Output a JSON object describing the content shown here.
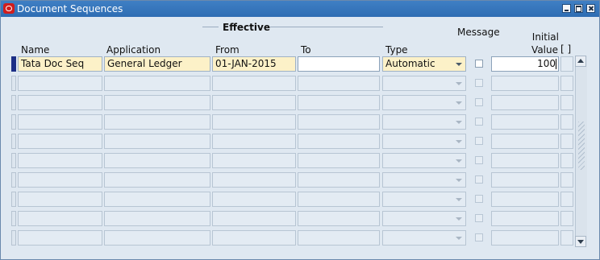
{
  "window": {
    "title": "Document Sequences",
    "app_icon": "oracle-icon"
  },
  "group": {
    "title": "Effective"
  },
  "headers": {
    "name": "Name",
    "application": "Application",
    "from": "From",
    "to": "To",
    "type": "Type",
    "message": "Message",
    "initial_line1": "Initial",
    "initial_line2": "Value",
    "bracket": "[ ]"
  },
  "rows": [
    {
      "name": "Tata Doc Seq",
      "application": "General Ledger",
      "from": "01-JAN-2015",
      "to": "",
      "type": "Automatic",
      "message": false,
      "initial_value": "100"
    },
    {
      "name": "",
      "application": "",
      "from": "",
      "to": "",
      "type": "",
      "message": false,
      "initial_value": ""
    },
    {
      "name": "",
      "application": "",
      "from": "",
      "to": "",
      "type": "",
      "message": false,
      "initial_value": ""
    },
    {
      "name": "",
      "application": "",
      "from": "",
      "to": "",
      "type": "",
      "message": false,
      "initial_value": ""
    },
    {
      "name": "",
      "application": "",
      "from": "",
      "to": "",
      "type": "",
      "message": false,
      "initial_value": ""
    },
    {
      "name": "",
      "application": "",
      "from": "",
      "to": "",
      "type": "",
      "message": false,
      "initial_value": ""
    },
    {
      "name": "",
      "application": "",
      "from": "",
      "to": "",
      "type": "",
      "message": false,
      "initial_value": ""
    },
    {
      "name": "",
      "application": "",
      "from": "",
      "to": "",
      "type": "",
      "message": false,
      "initial_value": ""
    },
    {
      "name": "",
      "application": "",
      "from": "",
      "to": "",
      "type": "",
      "message": false,
      "initial_value": ""
    },
    {
      "name": "",
      "application": "",
      "from": "",
      "to": "",
      "type": "",
      "message": false,
      "initial_value": ""
    }
  ],
  "colors": {
    "titlebar": "#2e6db3",
    "active_field": "#fcf1c8",
    "inactive_field": "#e3ebf3",
    "background": "#dfe8f1",
    "current_record": "#1c2f86"
  }
}
